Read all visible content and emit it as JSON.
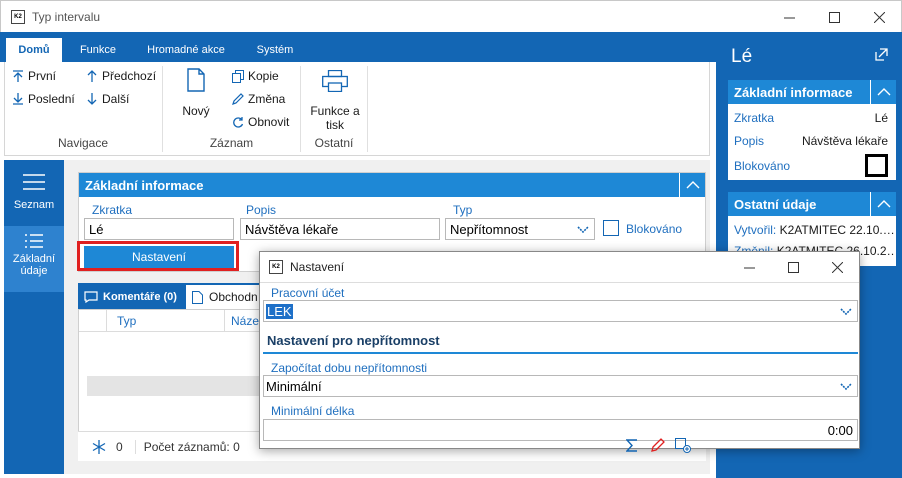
{
  "window": {
    "title": "Typ intervalu",
    "app_icon_text": "K2"
  },
  "ribbon": {
    "tabs": [
      "Domů",
      "Funkce",
      "Hromadné akce",
      "Systém"
    ],
    "navigation": {
      "first": "První",
      "last": "Poslední",
      "previous": "Předchozí",
      "next": "Další",
      "group_label": "Navigace"
    },
    "record": {
      "new": "Nový",
      "copy": "Kopie",
      "change": "Změna",
      "refresh": "Obnovit",
      "group_label": "Záznam"
    },
    "other": {
      "print_line1": "Funkce a",
      "print_line2": "tisk",
      "group_label": "Ostatní"
    }
  },
  "leftnav": {
    "items": [
      {
        "label": "Seznam"
      },
      {
        "label_line1": "Základní",
        "label_line2": "údaje"
      }
    ]
  },
  "main": {
    "section_title": "Základní informace",
    "fields": {
      "zkratka": {
        "label": "Zkratka",
        "value": "Lé"
      },
      "popis": {
        "label": "Popis",
        "value": "Návštěva lékaře"
      },
      "typ": {
        "label": "Typ",
        "value": "Nepřítomnost"
      },
      "blokovano": {
        "label": "Blokováno"
      }
    },
    "settings_button": "Nastavení",
    "tabs": [
      {
        "label": "Komentáře (0)"
      },
      {
        "label": "Obchodn"
      }
    ],
    "table": {
      "columns": [
        "Typ",
        "Název"
      ]
    },
    "footer": {
      "count_zero": "0",
      "record_count": "Počet záznamů: 0"
    }
  },
  "rightpane": {
    "title": "Lé",
    "basic": {
      "title": "Základní informace",
      "rows": [
        {
          "label": "Zkratka",
          "value": "Lé"
        },
        {
          "label": "Popis",
          "value": "Návštěva lékaře"
        },
        {
          "label": "Blokováno"
        }
      ]
    },
    "other": {
      "title": "Ostatní údaje",
      "created_label": "Vytvořil:",
      "created_value": "K2ATMITEC 22.10.…",
      "changed_label": "Změnil:",
      "changed_value": "K2ATMITEC 26.10.2…"
    }
  },
  "dialog": {
    "title": "Nastavení",
    "icon_text": "K2",
    "pracovni_ucet": {
      "label": "Pracovní účet",
      "value": "LEK"
    },
    "section_title": "Nastavení pro nepřítomnost",
    "zapocitat": {
      "label": "Započítat dobu nepřítomnosti",
      "value": "Minimální"
    },
    "min_delka": {
      "label": "Minimální délka",
      "value": "0:00"
    }
  },
  "colors": {
    "accent": "#1366b4",
    "section": "#1e88d6",
    "highlight": "#e02020",
    "selection": "#1e70c8"
  }
}
